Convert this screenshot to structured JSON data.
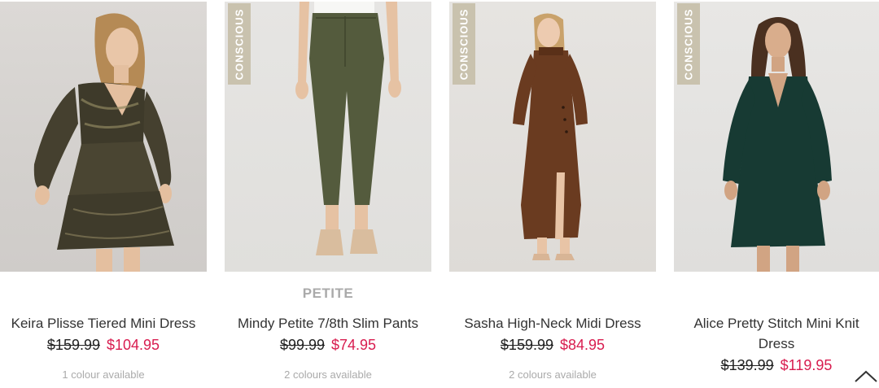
{
  "products": [
    {
      "badge": "",
      "label": "",
      "name": "Keira Plisse Tiered Mini Dress",
      "was_price": "$159.99",
      "now_price": "$104.95",
      "colours": "1 colour available"
    },
    {
      "badge": "CONSCIOUS",
      "label": "PETITE",
      "name": "Mindy Petite 7/8th Slim Pants",
      "was_price": "$99.99",
      "now_price": "$74.95",
      "colours": "2 colours available"
    },
    {
      "badge": "CONSCIOUS",
      "label": "",
      "name": "Sasha High-Neck Midi Dress",
      "was_price": "$159.99",
      "now_price": "$84.95",
      "colours": "2 colours available"
    },
    {
      "badge": "CONSCIOUS",
      "label": "",
      "name": "Alice Pretty Stitch Mini Knit Dress",
      "was_price": "$139.99",
      "now_price": "$119.95",
      "colours": ""
    }
  ],
  "colors": {
    "sale_price": "#d81c4f",
    "badge_bg": "#c9c2ae",
    "muted_text": "#aaaaaa"
  },
  "icons": {
    "scroll_top": "chevron-up-icon"
  }
}
